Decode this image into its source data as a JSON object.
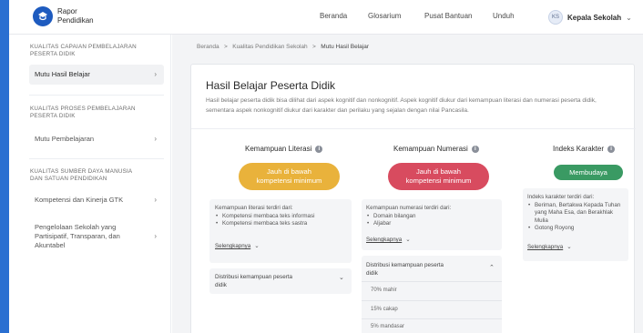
{
  "header": {
    "brand_line1": "Rapor",
    "brand_line2": "Pendidikan",
    "nav": [
      "Beranda",
      "Glosarium",
      "Pusat Bantuan",
      "Unduh"
    ],
    "profile": {
      "initials": "KS",
      "name": "Kepala Sekolah"
    }
  },
  "sidebar": {
    "sections": [
      {
        "title_line1": "KUALITAS CAPAIAN PEMBELAJARAN",
        "title_line2": "PESERTA DIDIK",
        "items": [
          {
            "label": "Mutu Hasil Belajar"
          }
        ]
      },
      {
        "title_line1": "KUALITAS PROSES PEMBELAJARAN",
        "title_line2": "PESERTA DIDIK",
        "items": [
          {
            "label": "Mutu Pembelajaran"
          }
        ]
      },
      {
        "title_line1": "KUALITAS SUMBER DAYA MANUSIA",
        "title_line2": "DAN SATUAN PENDIDIKAN",
        "items": [
          {
            "label": "Kompetensi dan Kinerja GTK"
          },
          {
            "label_line1": "Pengelolaan Sekolah yang",
            "label_line2": "Partisipatif, Transparan, dan",
            "label_line3": "Akuntabel"
          }
        ]
      }
    ]
  },
  "breadcrumb": [
    "Beranda",
    "Kualitas Pendidikan Sekolah",
    "Mutu Hasil Belajar"
  ],
  "main": {
    "title": "Hasil Belajar Peserta Didik",
    "description": "Hasil belajar peserta didik bisa dilihat dari aspek kognitif dan nonkognitif. Aspek kognitif diukur dari kemampuan literasi dan numerasi peserta didik, sementara aspek nonkognitif diukur dari karakter dan perilaku yang sejalan dengan nilai Pancasila.",
    "columns": [
      {
        "title": "Kemampuan Literasi",
        "status_line1": "Jauh di bawah",
        "status_line2": "kompetensi minimum",
        "status_color": "#e9b23b",
        "intro": "Kemampuan literasi terdiri dari:",
        "bullets": [
          "Kompetensi membaca teks informasi",
          "Kompetensi membaca teks sastra"
        ],
        "more": "Selengkapnya",
        "dist_line1": "Distribusi kemampuan peserta",
        "dist_line2": "didik"
      },
      {
        "title": "Kemampuan Numerasi",
        "status_line1": "Jauh di bawah",
        "status_line2": "kompetensi minimum",
        "status_color": "#d84b5f",
        "intro": "Kemampuan numerasi terdiri dari:",
        "bullets": [
          "Domain bilangan",
          "Aljabar"
        ],
        "more": "Selengkapnya",
        "dist_line1": "Distribusi kemampuan peserta",
        "dist_line2": "didik",
        "dist_rows": [
          "70% mahir",
          "15% cakap",
          "5% mandasar"
        ]
      },
      {
        "title": "Indeks Karakter",
        "status_line1": "Membudaya",
        "status_color": "#3a9a63",
        "intro": "Indeks karakter terdiri dari:",
        "bullets": [
          "Beriman, Bertakwa Kepada Tuhan yang Maha Esa, dan Berakhlak Mulia",
          "Gotong Royong"
        ],
        "more": "Selengkapnya"
      }
    ]
  }
}
